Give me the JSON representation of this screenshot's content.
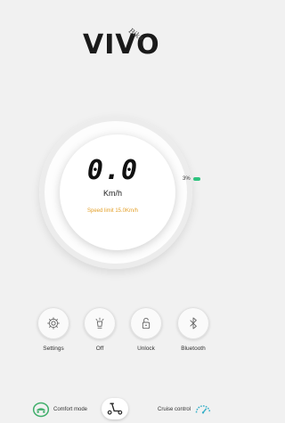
{
  "brand": {
    "name": "VIVO",
    "sub": "Bike"
  },
  "gauge": {
    "speed": "0.0",
    "unit": "Km/h",
    "speed_limit": "Speed limit 15.0Km/h",
    "battery_text": "3%",
    "battery_level": 0.03
  },
  "controls": [
    {
      "label": "Settings",
      "icon": "gear-icon"
    },
    {
      "label": "Off",
      "icon": "light-icon"
    },
    {
      "label": "Unlock",
      "icon": "lock-icon"
    },
    {
      "label": "Bluetooth",
      "icon": "bluetooth-icon"
    }
  ],
  "bottom": {
    "comfort_label": "Comfort mode",
    "cruise_label": "Cruise control"
  },
  "colors": {
    "accent_orange": "#e3a02a",
    "battery_green": "#2ec27e",
    "mode_green": "#3fae6a",
    "cruise_teal": "#3ab0c8"
  }
}
